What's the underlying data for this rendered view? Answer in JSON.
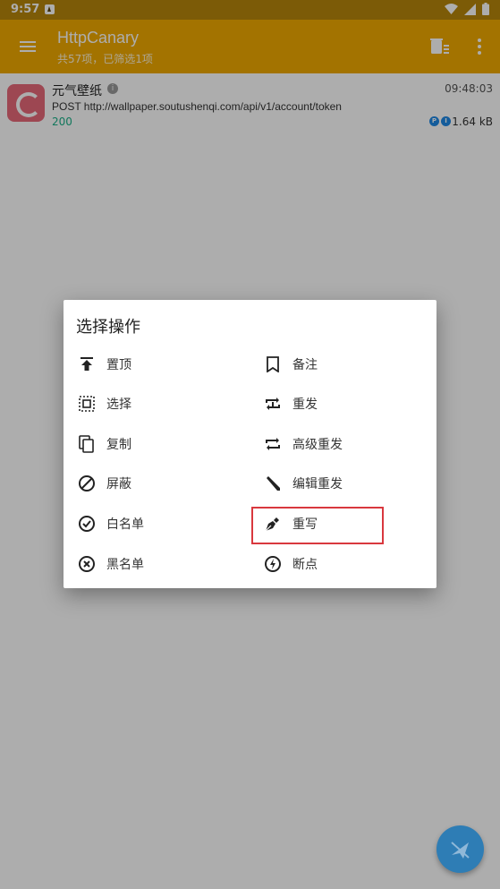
{
  "status_bar": {
    "time": "9:57"
  },
  "app_bar": {
    "title": "HttpCanary",
    "subtitle": "共57项，已筛选1项"
  },
  "request": {
    "app_name": "元气壁纸",
    "time": "09:48:03",
    "method_url": "POST http://wallpaper.soutushenqi.com/api/v1/account/token",
    "status": "200",
    "size": "1.64 kB",
    "badge1": "P",
    "badge2": "I"
  },
  "dialog": {
    "title": "选择操作",
    "left": [
      {
        "label": "置顶",
        "icon": "pin-top-icon"
      },
      {
        "label": "选择",
        "icon": "select-icon"
      },
      {
        "label": "复制",
        "icon": "copy-icon"
      },
      {
        "label": "屏蔽",
        "icon": "block-icon"
      },
      {
        "label": "白名单",
        "icon": "check-circle-icon"
      },
      {
        "label": "黑名单",
        "icon": "x-circle-icon"
      }
    ],
    "right": [
      {
        "label": "备注",
        "icon": "bookmark-icon"
      },
      {
        "label": "重发",
        "icon": "repeat-one-icon"
      },
      {
        "label": "高级重发",
        "icon": "repeat-icon"
      },
      {
        "label": "编辑重发",
        "icon": "pencil-icon"
      },
      {
        "label": "重写",
        "icon": "pen-nib-icon"
      },
      {
        "label": "断点",
        "icon": "breakpoint-icon"
      }
    ]
  },
  "colors": {
    "app_bar": "#f0aa00",
    "status_bar": "#b7860b",
    "fab": "#2e7db5",
    "highlight": "#d9383e",
    "status_ok": "#1bb188"
  }
}
